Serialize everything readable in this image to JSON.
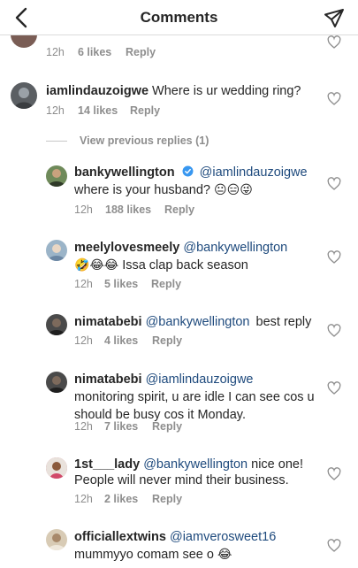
{
  "header": {
    "title": "Comments"
  },
  "view_previous": "View previous replies (1)",
  "comments": [
    {
      "username": "",
      "mention": "",
      "text": "",
      "time": "12h",
      "likes": "6 likes",
      "reply": "Reply",
      "avatar_color": "#7a5d55"
    },
    {
      "username": "iamlindauzoigwe",
      "text": "Where is ur wedding ring?",
      "time": "12h",
      "likes": "14 likes",
      "reply": "Reply",
      "avatar_color": "#5b5f63"
    },
    {
      "username": "bankywellington",
      "verified": true,
      "mention": "@iamlindauzoigwe",
      "line2": "where is your husband?",
      "emojis": [
        "😐",
        "😑",
        "😜"
      ],
      "time": "12h",
      "likes": "188 likes",
      "reply": "Reply",
      "avatar_color": "#6f8a5a"
    },
    {
      "username": "meelylovesmeely",
      "mention": "@bankywellington",
      "emojis": [
        "🤣",
        "😂",
        "😂"
      ],
      "line2": "Issa clap back season",
      "time": "12h",
      "likes": "5 likes",
      "reply": "Reply",
      "avatar_color": "#9bb4c8"
    },
    {
      "username": "nimatabebi",
      "mention": "@bankywellington",
      "text": "best reply",
      "time": "12h",
      "likes": "4 likes",
      "reply": "Reply",
      "avatar_color": "#4a4a4a"
    },
    {
      "username": "nimatabebi",
      "mention": "@iamlindauzoigwe",
      "line2": "monitoring spirit, u are idle I can see cos u",
      "line3": "should be busy cos it Monday.",
      "time": "12h",
      "likes": "7 likes",
      "reply": "Reply",
      "avatar_color": "#4a4a4a"
    },
    {
      "username": "1st___lady",
      "mention": "@bankywellington",
      "text": "nice one!",
      "line2": "People will never mind their business.",
      "time": "12h",
      "likes": "2 likes",
      "reply": "Reply",
      "avatar_color": "#c46a7a"
    },
    {
      "username": "officiallextwins",
      "mention": "@iamverosweet16",
      "line2": "mummyyo comam see o",
      "emojis": [
        "😂"
      ],
      "avatar_color": "#d8cbb5"
    }
  ],
  "colors": {
    "mention": "#1e4a7d",
    "meta": "#8e8e8e",
    "verified": "#3897f0",
    "divider": "#dbdbdb"
  }
}
